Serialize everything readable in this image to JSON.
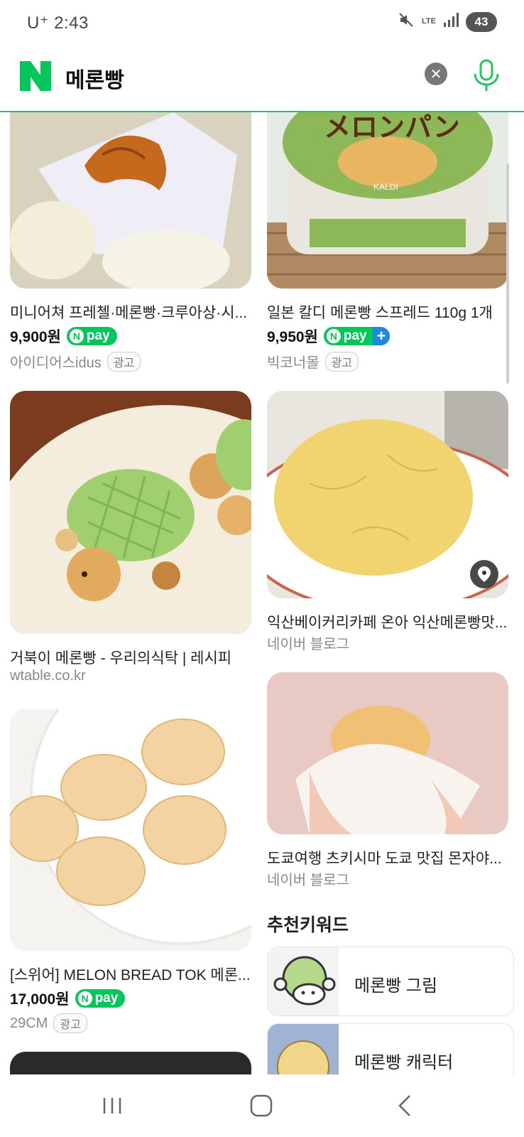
{
  "status_bar": {
    "time": "U⁺ 2:43",
    "lte": "LTE",
    "battery": "43"
  },
  "search": {
    "query": "메론빵",
    "logo_letter": "N"
  },
  "npay_label": "pay",
  "results": {
    "left": [
      {
        "title": "미니어쳐 프레첼·메론빵·크루아상·시...",
        "price": "9,900원",
        "npay": true,
        "source": "아이디어스idus",
        "ad": "광고"
      },
      {
        "title": "거북이 메론빵 - 우리의식탁 | 레시피",
        "source": "wtable.co.kr"
      },
      {
        "title": "[스위어] MELON BREAD TOK 메론...",
        "price": "17,000원",
        "npay": true,
        "source": "29CM",
        "ad": "광고"
      }
    ],
    "right": [
      {
        "title": "일본 칼디 메론빵 스프레드 110g 1개",
        "price": "9,950원",
        "npay": true,
        "npay_plus": true,
        "source": "빅코너몰",
        "ad": "광고"
      },
      {
        "title": "익산베이커리카페 온아 익산메론빵맛...",
        "source": "네이버 블로그"
      },
      {
        "title": "도쿄여행 츠키시마 도쿄 맛집 몬자야...",
        "source": "네이버 블로그"
      }
    ]
  },
  "recommended": {
    "title": "추천키워드",
    "items": [
      {
        "label": "메론빵 그림"
      },
      {
        "label": "메론빵 캐릭터"
      }
    ]
  },
  "image_text": {
    "melonpan_jp": "メロンパン",
    "kaldi": "KALDI"
  },
  "colors": {
    "brand_green": "#03c75a",
    "header_divider": "#22c55e",
    "npay_plus_blue": "#1e88e5"
  }
}
